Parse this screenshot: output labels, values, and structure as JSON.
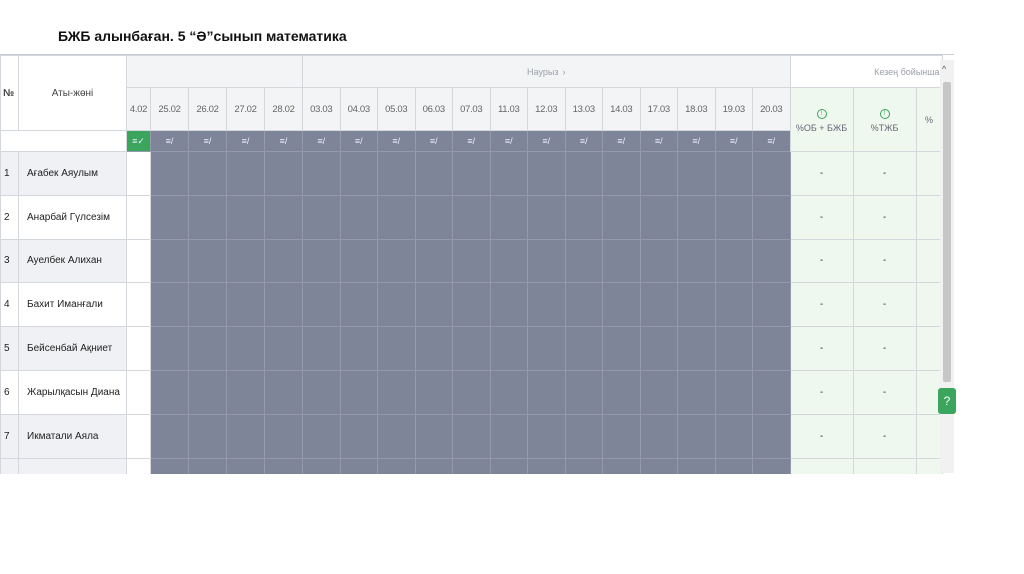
{
  "title": "БЖБ алынбаған. 5 “Ә”сынып   математика",
  "header": {
    "num_label": "№",
    "name_label": "Аты-жөні",
    "month_label": "Наурыз",
    "month_arrow": "›",
    "period_label": "Кезең бойынша",
    "dates_feb": [
      "4.02",
      "25.02",
      "26.02",
      "27.02",
      "28.02"
    ],
    "dates_mar": [
      "03.03",
      "04.03",
      "05.03",
      "06.03",
      "07.03",
      "11.03",
      "12.03",
      "13.03",
      "14.03",
      "17.03",
      "18.03",
      "19.03",
      "20.03"
    ],
    "summary_cols": [
      "%ОБ + БЖБ",
      "%ТЖБ",
      "%"
    ]
  },
  "students": [
    {
      "num": "1",
      "name": "Ағабек Аяулым",
      "v1": "-",
      "v2": "-"
    },
    {
      "num": "2",
      "name": "Анарбай Гүлсезім",
      "v1": "-",
      "v2": "-"
    },
    {
      "num": "3",
      "name": "Ауелбек Алихан",
      "v1": "-",
      "v2": "-"
    },
    {
      "num": "4",
      "name": "Бахит Иманғали",
      "v1": "-",
      "v2": "-"
    },
    {
      "num": "5",
      "name": "Бейсенбай Ақниет",
      "v1": "-",
      "v2": "-"
    },
    {
      "num": "6",
      "name": "Жарылқасын Диана",
      "v1": "-",
      "v2": "-"
    },
    {
      "num": "7",
      "name": "Икматали Аяла",
      "v1": "-",
      "v2": "-"
    }
  ],
  "icons": {
    "grade_icon": "≡/",
    "grade_icon_active": "≡✓",
    "info_icon": "!",
    "scroll_up": "^",
    "help": "?"
  },
  "colors": {
    "shaded": "#7e8599",
    "accent": "#3ba55d",
    "summary_bg": "#eef8ee"
  }
}
